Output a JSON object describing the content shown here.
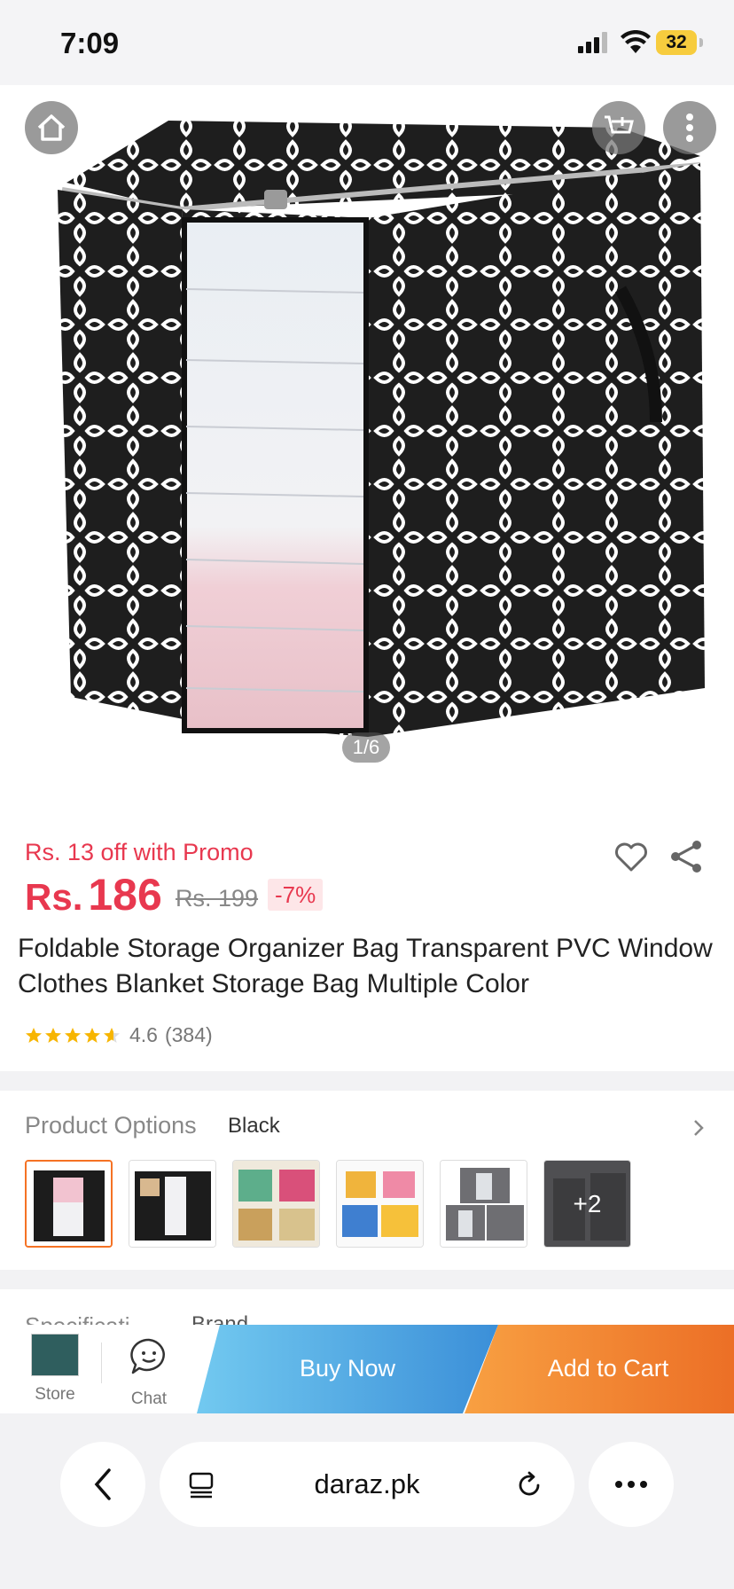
{
  "status_bar": {
    "time": "7:09",
    "battery": "32"
  },
  "gallery": {
    "counter": "1/6"
  },
  "product": {
    "promo_text": "Rs. 13 off with Promo",
    "currency": "Rs.",
    "price": "186",
    "original_price": "Rs. 199",
    "discount": "-7%",
    "title": "Foldable Storage Organizer Bag Transparent PVC Window Clothes Blanket Storage Bag Multiple Color",
    "rating": {
      "stars": 4.6,
      "score": "4.6",
      "count": "(384)"
    }
  },
  "options": {
    "label": "Product Options",
    "selected": "Black",
    "more_count": "+2"
  },
  "specs_peek": {
    "label": "Specificati",
    "value": "Brand"
  },
  "action_bar": {
    "store_label": "Store",
    "chat_label": "Chat",
    "buy_now": "Buy Now",
    "add_to_cart": "Add to Cart"
  },
  "browser": {
    "url": "daraz.pk"
  },
  "colors": {
    "accent_red": "#e8384f",
    "orange": "#f57224",
    "buy_blue": "#4aa9e0"
  }
}
